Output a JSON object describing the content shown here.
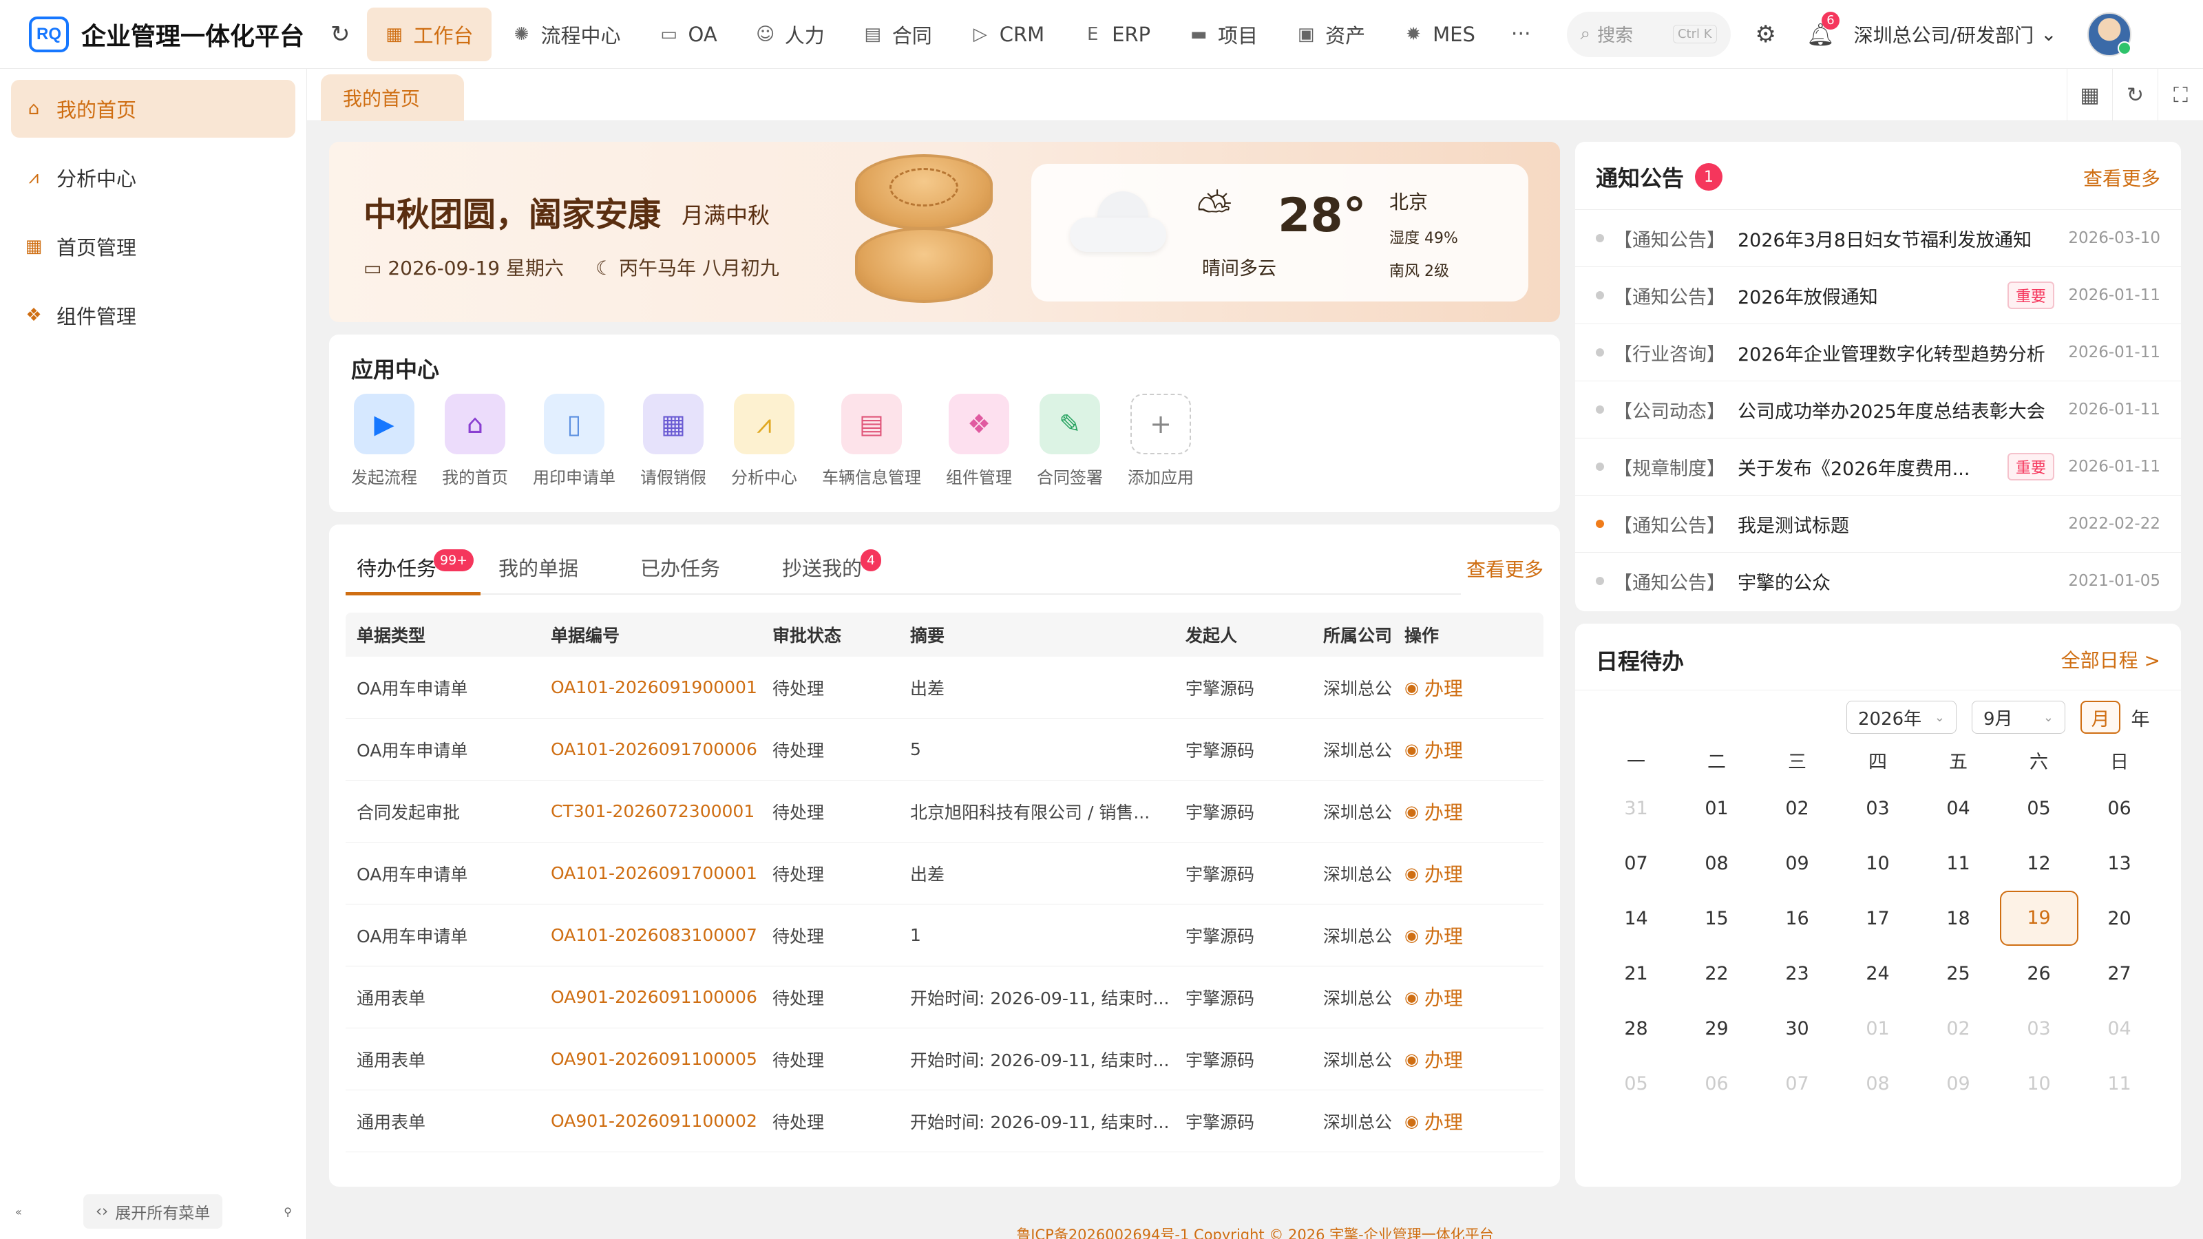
{
  "header": {
    "logo": "RQ",
    "title": "企业管理一体化平台",
    "nav": [
      {
        "label": "工作台",
        "icon": "grid-icon",
        "glyph": "▦",
        "active": true
      },
      {
        "label": "流程中心",
        "icon": "workflow-icon",
        "glyph": "✺"
      },
      {
        "label": "OA",
        "icon": "oa-icon",
        "glyph": "▭"
      },
      {
        "label": "人力",
        "icon": "people-icon",
        "glyph": "☺"
      },
      {
        "label": "合同",
        "icon": "contract-icon",
        "glyph": "▤"
      },
      {
        "label": "CRM",
        "icon": "crm-icon",
        "glyph": "▷"
      },
      {
        "label": "ERP",
        "icon": "erp-icon",
        "glyph": "E"
      },
      {
        "label": "项目",
        "icon": "project-icon",
        "glyph": "▬"
      },
      {
        "label": "资产",
        "icon": "asset-icon",
        "glyph": "▣"
      },
      {
        "label": "MES",
        "icon": "mes-icon",
        "glyph": "✹"
      }
    ],
    "more": "···",
    "search_placeholder": "搜索",
    "search_shortcut": "Ctrl K",
    "notification_count": "6",
    "org": "深圳总公司/研发部门"
  },
  "sidebar": {
    "items": [
      {
        "label": "我的首页",
        "icon": "home-icon",
        "glyph": "⌂",
        "active": true
      },
      {
        "label": "分析中心",
        "icon": "analysis-icon",
        "glyph": "⩘"
      },
      {
        "label": "首页管理",
        "icon": "layout-icon",
        "glyph": "▦"
      },
      {
        "label": "组件管理",
        "icon": "component-icon",
        "glyph": "❖"
      }
    ],
    "expand_label": "展开所有菜单"
  },
  "tabs": {
    "active": "我的首页"
  },
  "banner": {
    "title": "中秋团圆，阖家安康",
    "subtitle": "月满中秋",
    "date": "2026-09-19 星期六",
    "lunar": "丙午马年 八月初九",
    "weather": {
      "temp": "28°",
      "desc": "晴间多云",
      "city": "北京",
      "humidity": "湿度 49%",
      "wind": "南风 2级"
    }
  },
  "apps": {
    "title": "应用中心",
    "items": [
      {
        "label": "发起流程",
        "icon": "play-icon",
        "glyph": "▶",
        "bg": "#d6e8ff",
        "fg": "#1677ff"
      },
      {
        "label": "我的首页",
        "icon": "home-icon",
        "glyph": "⌂",
        "bg": "#ecdcfb",
        "fg": "#8a3fd1"
      },
      {
        "label": "用印申请单",
        "icon": "document-icon",
        "glyph": "▯",
        "bg": "#e2efff",
        "fg": "#5b8fe0"
      },
      {
        "label": "请假销假",
        "icon": "calendar-icon",
        "glyph": "▦",
        "bg": "#e6e2fb",
        "fg": "#6a5bd3"
      },
      {
        "label": "分析中心",
        "icon": "chart-icon",
        "glyph": "⩘",
        "bg": "#fdf1d0",
        "fg": "#e0a820"
      },
      {
        "label": "车辆信息管理",
        "icon": "car-icon",
        "glyph": "▤",
        "bg": "#fde3ea",
        "fg": "#e0567a"
      },
      {
        "label": "组件管理",
        "icon": "component-icon",
        "glyph": "❖",
        "bg": "#fde0ef",
        "fg": "#e05aa0"
      },
      {
        "label": "合同签署",
        "icon": "sign-icon",
        "glyph": "✎",
        "bg": "#dcf3e4",
        "fg": "#27a360"
      },
      {
        "label": "添加应用",
        "icon": "plus-icon",
        "glyph": "+",
        "bg": "#ffffff",
        "fg": "#888888"
      }
    ]
  },
  "tasks": {
    "tabs": [
      {
        "label": "待办任务",
        "badge": "99+"
      },
      {
        "label": "我的单据",
        "badge": ""
      },
      {
        "label": "已办任务",
        "badge": ""
      },
      {
        "label": "抄送我的",
        "badge": "4"
      }
    ],
    "more": "查看更多",
    "columns": [
      "单据类型",
      "单据编号",
      "审批状态",
      "摘要",
      "发起人",
      "所属公司",
      "操作"
    ],
    "rows": [
      {
        "type": "OA用车申请单",
        "code": "OA101-2026091900001",
        "status": "待处理",
        "summary": "出差",
        "initiator": "宇擎源码",
        "company": "深圳总公司",
        "action": "办理"
      },
      {
        "type": "OA用车申请单",
        "code": "OA101-2026091700006",
        "status": "待处理",
        "summary": "5",
        "initiator": "宇擎源码",
        "company": "深圳总公司",
        "action": "办理"
      },
      {
        "type": "合同发起审批",
        "code": "CT301-2026072300001",
        "status": "待处理",
        "summary": "北京旭阳科技有限公司 / 销售...",
        "initiator": "宇擎源码",
        "company": "深圳总公司",
        "action": "办理"
      },
      {
        "type": "OA用车申请单",
        "code": "OA101-2026091700001",
        "status": "待处理",
        "summary": "出差",
        "initiator": "宇擎源码",
        "company": "深圳总公司",
        "action": "办理"
      },
      {
        "type": "OA用车申请单",
        "code": "OA101-2026083100007",
        "status": "待处理",
        "summary": "1",
        "initiator": "宇擎源码",
        "company": "深圳总公司",
        "action": "办理"
      },
      {
        "type": "通用表单",
        "code": "OA901-2026091100006",
        "status": "待处理",
        "summary": "开始时间: 2026-09-11, 结束时...",
        "initiator": "宇擎源码",
        "company": "深圳总公司",
        "action": "办理"
      },
      {
        "type": "通用表单",
        "code": "OA901-2026091100005",
        "status": "待处理",
        "summary": "开始时间: 2026-09-11, 结束时...",
        "initiator": "宇擎源码",
        "company": "深圳总公司",
        "action": "办理"
      },
      {
        "type": "通用表单",
        "code": "OA901-2026091100002",
        "status": "待处理",
        "summary": "开始时间: 2026-09-11, 结束时...",
        "initiator": "宇擎源码",
        "company": "深圳总公司",
        "action": "办理"
      }
    ]
  },
  "notices": {
    "title": "通知公告",
    "badge": "1",
    "more": "查看更多",
    "items": [
      {
        "cat": "【通知公告】",
        "title": "2026年3月8日妇女节福利发放通知",
        "tag": "",
        "date": "2026-03-10",
        "new": false
      },
      {
        "cat": "【通知公告】",
        "title": "2026年放假通知",
        "tag": "重要",
        "date": "2026-01-11",
        "new": false
      },
      {
        "cat": "【行业咨询】",
        "title": "2026年企业管理数字化转型趋势分析",
        "tag": "",
        "date": "2026-01-11",
        "new": false
      },
      {
        "cat": "【公司动态】",
        "title": "公司成功举办2025年度总结表彰大会",
        "tag": "",
        "date": "2026-01-11",
        "new": false
      },
      {
        "cat": "【规章制度】",
        "title": "关于发布《2026年度费用...",
        "tag": "重要",
        "date": "2026-01-11",
        "new": false
      },
      {
        "cat": "【通知公告】",
        "title": "我是测试标题",
        "tag": "",
        "date": "2022-02-22",
        "new": true
      },
      {
        "cat": "【通知公告】",
        "title": "宇擎的公众",
        "tag": "",
        "date": "2021-01-05",
        "new": false
      }
    ]
  },
  "schedule": {
    "title": "日程待办",
    "more": "全部日程 >",
    "year": "2026年",
    "month": "9月",
    "mode_month": "月",
    "mode_year": "年",
    "weekdays": [
      "一",
      "二",
      "三",
      "四",
      "五",
      "六",
      "日"
    ],
    "weeks": [
      [
        {
          "d": "31",
          "dim": true
        },
        {
          "d": "01"
        },
        {
          "d": "02"
        },
        {
          "d": "03"
        },
        {
          "d": "04"
        },
        {
          "d": "05"
        },
        {
          "d": "06"
        }
      ],
      [
        {
          "d": "07"
        },
        {
          "d": "08"
        },
        {
          "d": "09"
        },
        {
          "d": "10"
        },
        {
          "d": "11"
        },
        {
          "d": "12"
        },
        {
          "d": "13"
        }
      ],
      [
        {
          "d": "14"
        },
        {
          "d": "15"
        },
        {
          "d": "16"
        },
        {
          "d": "17"
        },
        {
          "d": "18"
        },
        {
          "d": "19",
          "today": true
        },
        {
          "d": "20"
        }
      ],
      [
        {
          "d": "21"
        },
        {
          "d": "22"
        },
        {
          "d": "23"
        },
        {
          "d": "24"
        },
        {
          "d": "25"
        },
        {
          "d": "26"
        },
        {
          "d": "27"
        }
      ],
      [
        {
          "d": "28"
        },
        {
          "d": "29"
        },
        {
          "d": "30"
        },
        {
          "d": "01",
          "dim": true
        },
        {
          "d": "02",
          "dim": true
        },
        {
          "d": "03",
          "dim": true
        },
        {
          "d": "04",
          "dim": true
        }
      ],
      [
        {
          "d": "05",
          "dim": true
        },
        {
          "d": "06",
          "dim": true
        },
        {
          "d": "07",
          "dim": true
        },
        {
          "d": "08",
          "dim": true
        },
        {
          "d": "09",
          "dim": true
        },
        {
          "d": "10",
          "dim": true
        },
        {
          "d": "11",
          "dim": true
        }
      ]
    ]
  },
  "footer": "鲁ICP备2026002694号-1 Copyright © 2026 宇擎-企业管理一体化平台",
  "colors": {
    "accent": "#cf6e12",
    "badge": "#f5365c"
  }
}
